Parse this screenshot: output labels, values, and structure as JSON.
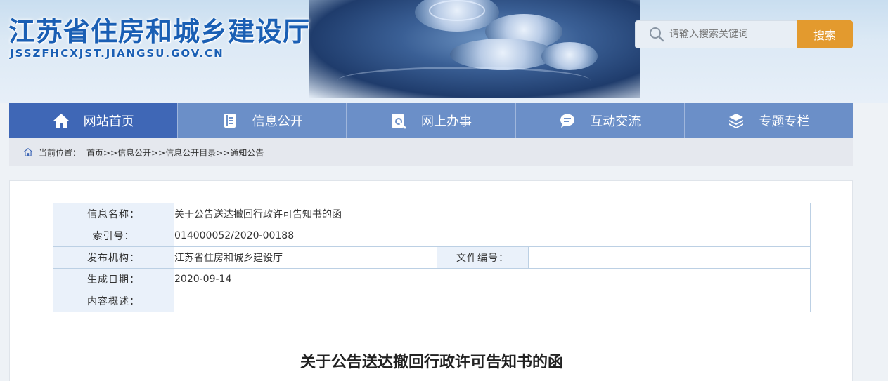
{
  "header": {
    "site_title": "江苏省住房和城乡建设厅",
    "site_url": "JSSZFHCXJST.JIANGSU.GOV.CN"
  },
  "search": {
    "placeholder": "请输入搜索关键词",
    "button_label": "搜索"
  },
  "nav": {
    "items": [
      {
        "label": "网站首页",
        "icon": "home-icon"
      },
      {
        "label": "信息公开",
        "icon": "document-icon"
      },
      {
        "label": "网上办事",
        "icon": "search-doc-icon"
      },
      {
        "label": "互动交流",
        "icon": "chat-icon"
      },
      {
        "label": "专题专栏",
        "icon": "layers-icon"
      }
    ]
  },
  "breadcrumb": {
    "prefix": "当前位置：",
    "path": "首页>>信息公开>>信息公开目录>>通知公告"
  },
  "meta": {
    "name_label": "信息名称：",
    "name_value": "关于公告送达撤回行政许可告知书的函",
    "index_label": "索引号：",
    "index_value": "014000052/2020-00188",
    "org_label": "发布机构：",
    "org_value": "江苏省住房和城乡建设厅",
    "docno_label": "文件编号：",
    "docno_value": "",
    "date_label": "生成日期：",
    "date_value": "2020-09-14",
    "summary_label": "内容概述：",
    "summary_value": ""
  },
  "document": {
    "title": "关于公告送达撤回行政许可告知书的函"
  },
  "colors": {
    "nav_bg": "#6b8fc8",
    "nav_active": "#3f67b6",
    "search_button": "#e39a2e",
    "title_blue": "#1a5fb4"
  }
}
